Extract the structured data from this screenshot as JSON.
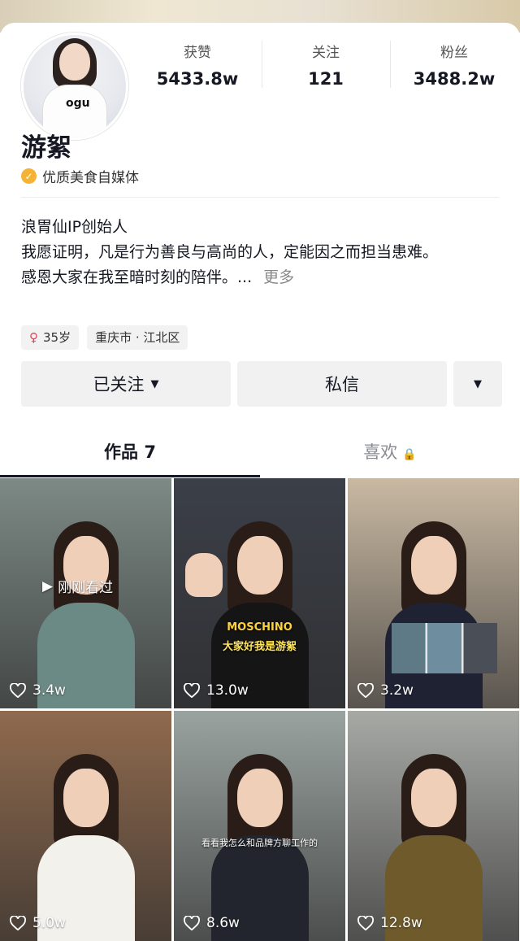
{
  "profile": {
    "name": "游絮",
    "verification": "优质美食自媒体",
    "avatar_logo": "ogu",
    "stats": [
      {
        "label": "获赞",
        "value": "5433.8w"
      },
      {
        "label": "关注",
        "value": "121"
      },
      {
        "label": "粉丝",
        "value": "3488.2w"
      }
    ],
    "bio_lines": [
      "浪胃仙IP创始人",
      "我愿证明，凡是行为善良与高尚的人，定能因之而担当患难。",
      "感恩大家在我至暗时刻的陪伴。..."
    ],
    "bio_more": "更多",
    "tags": {
      "age": "35岁",
      "location": "重庆市 · 江北区"
    }
  },
  "actions": {
    "follow_label": "已关注",
    "message_label": "私信"
  },
  "tabs": {
    "works_label": "作品 7",
    "likes_label": "喜欢"
  },
  "videos": [
    {
      "likes": "3.4w",
      "recent_label": "刚刚看过",
      "bg": "#7d8a86",
      "shirt": "#6c8a85"
    },
    {
      "likes": "13.0w",
      "caption": "大家好我是游絮",
      "shirt_text": "MOSCHINO",
      "bg": "#3b3f48",
      "shirt": "#151515"
    },
    {
      "likes": "3.2w",
      "bg": "#c9b9a3",
      "shirt": "#1f2233"
    },
    {
      "likes": "5.0w",
      "bg": "#8f6a4e",
      "shirt": "#f3f1ec"
    },
    {
      "likes": "8.6w",
      "caption": "看看我怎么和品牌方聊工作的",
      "bg": "#9aa3a0",
      "shirt": "#22252d"
    },
    {
      "likes": "12.8w",
      "bg": "#a7a9a5",
      "shirt": "#6e5a2b"
    }
  ]
}
